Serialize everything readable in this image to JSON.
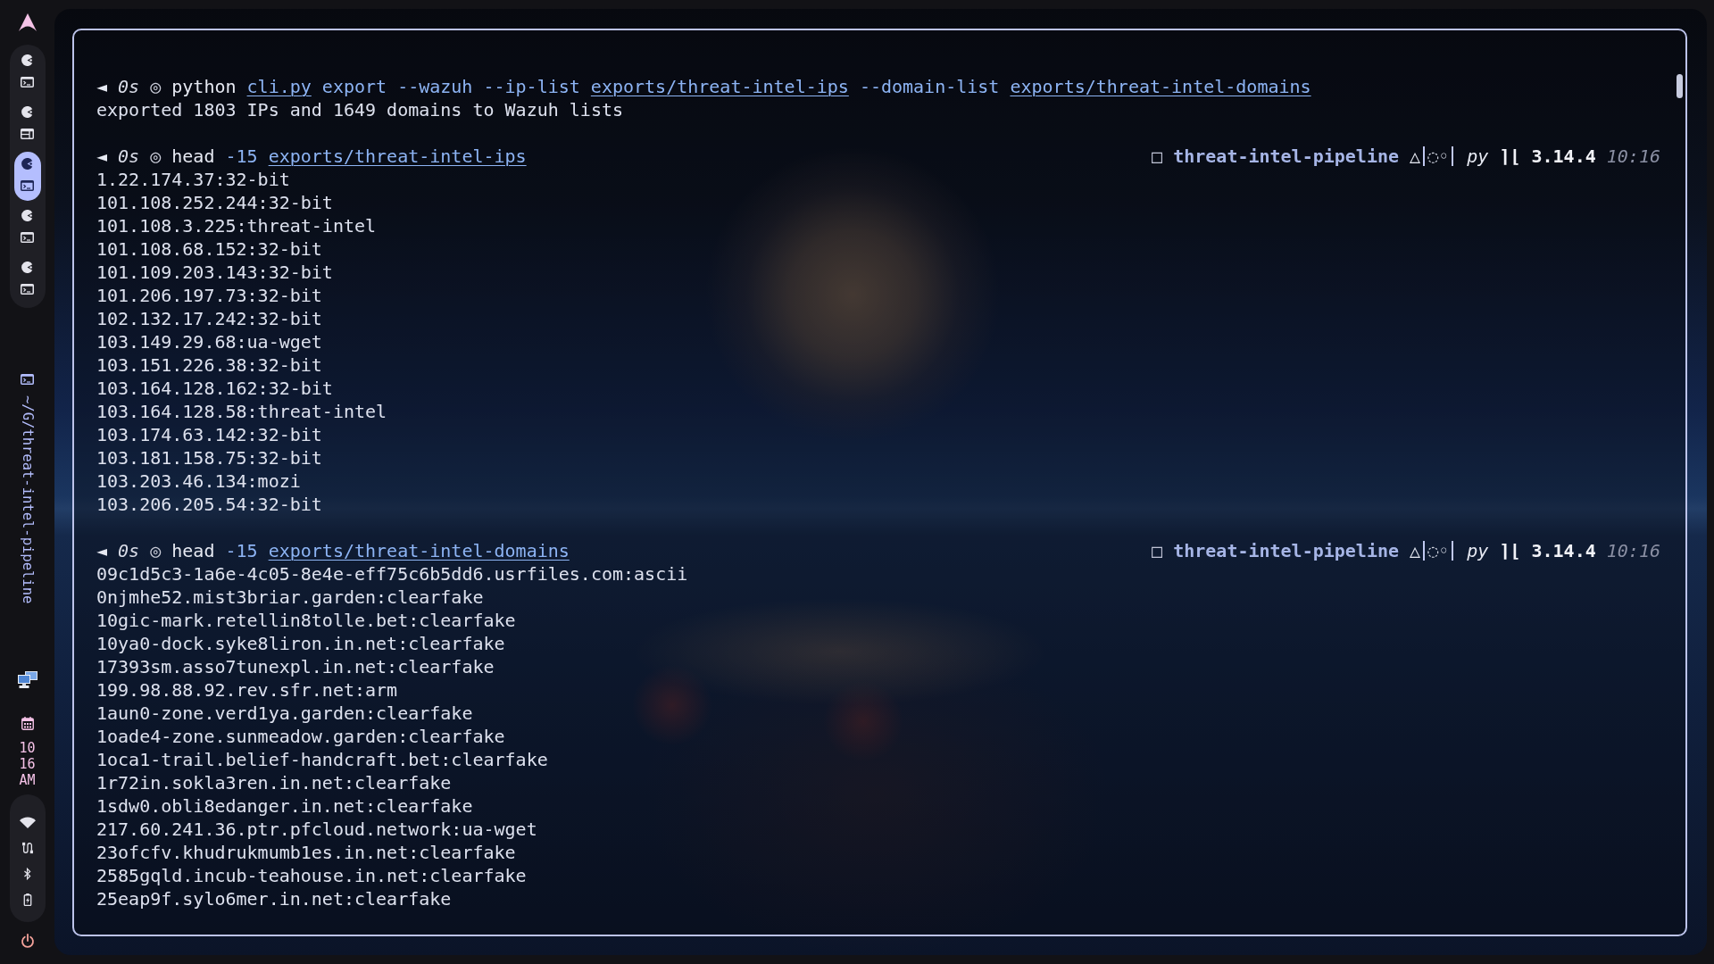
{
  "sidebar": {
    "workspaces": [
      {
        "kind": "terminal",
        "selected": false
      },
      {
        "kind": "window",
        "selected": false
      },
      {
        "kind": "terminal",
        "selected": true
      },
      {
        "kind": "terminal",
        "selected": false
      },
      {
        "kind": "terminal",
        "selected": false
      }
    ],
    "window_title": "~/G/threat-intel-pipeline",
    "clock": {
      "hour": "10",
      "minute": "16",
      "period": "AM"
    }
  },
  "terminal": {
    "blocks": [
      {
        "prompt": {
          "arrow": "◄",
          "duration": "0s",
          "status": "◎",
          "command": [
            {
              "kind": "cmd",
              "text": "python"
            },
            {
              "kind": "link",
              "text": "cli.py"
            },
            {
              "kind": "arg",
              "text": "export"
            },
            {
              "kind": "arg",
              "text": "--wazuh"
            },
            {
              "kind": "arg",
              "text": "--ip-list"
            },
            {
              "kind": "link",
              "text": "exports/threat-intel-ips"
            },
            {
              "kind": "arg",
              "text": "--domain-list"
            },
            {
              "kind": "link",
              "text": "exports/threat-intel-domains"
            }
          ]
        },
        "output": [
          "exported 1803 IPs and 1649 domains to Wazuh lists"
        ]
      },
      {
        "prompt": {
          "arrow": "◄",
          "duration": "0s",
          "status": "◎",
          "command": [
            {
              "kind": "cmd",
              "text": "head"
            },
            {
              "kind": "arg",
              "text": "-15"
            },
            {
              "kind": "link",
              "text": "exports/threat-intel-ips"
            }
          ]
        },
        "right_prompt": {
          "folder_icon": "□",
          "folder": "threat-intel-pipeline",
          "git_status": "△",
          "git_extra": "◌◦",
          "language": "py",
          "language_icon": "⌉⌊",
          "version": "3.14.4",
          "time": "10:16"
        },
        "output": [
          "1.22.174.37:32-bit",
          "101.108.252.244:32-bit",
          "101.108.3.225:threat-intel",
          "101.108.68.152:32-bit",
          "101.109.203.143:32-bit",
          "101.206.197.73:32-bit",
          "102.132.17.242:32-bit",
          "103.149.29.68:ua-wget",
          "103.151.226.38:32-bit",
          "103.164.128.162:32-bit",
          "103.164.128.58:threat-intel",
          "103.174.63.142:32-bit",
          "103.181.158.75:32-bit",
          "103.203.46.134:mozi",
          "103.206.205.54:32-bit"
        ]
      },
      {
        "prompt": {
          "arrow": "◄",
          "duration": "0s",
          "status": "◎",
          "command": [
            {
              "kind": "cmd",
              "text": "head"
            },
            {
              "kind": "arg",
              "text": "-15"
            },
            {
              "kind": "link",
              "text": "exports/threat-intel-domains"
            }
          ]
        },
        "right_prompt": {
          "folder_icon": "□",
          "folder": "threat-intel-pipeline",
          "git_status": "△",
          "git_extra": "◌◦",
          "language": "py",
          "language_icon": "⌉⌊",
          "version": "3.14.4",
          "time": "10:16"
        },
        "output": [
          "09c1d5c3-1a6e-4c05-8e4e-eff75c6b5dd6.usrfiles.com:ascii",
          "0njmhe52.mist3briar.garden:clearfake",
          "10gic-mark.retellin8tolle.bet:clearfake",
          "10ya0-dock.syke8liron.in.net:clearfake",
          "17393sm.asso7tunexpl.in.net:clearfake",
          "199.98.88.92.rev.sfr.net:arm",
          "1aun0-zone.verd1ya.garden:clearfake",
          "1oade4-zone.sunmeadow.garden:clearfake",
          "1oca1-trail.belief-handcraft.bet:clearfake",
          "1r72in.sokla3ren.in.net:clearfake",
          "1sdw0.obli8edanger.in.net:clearfake",
          "217.60.241.36.ptr.pfcloud.network:ua-wget",
          "23ofcfv.khudrukmumb1es.in.net:clearfake",
          "2585gqld.incub-teahouse.in.net:clearfake",
          "25eap9f.sylo6mer.in.net:clearfake"
        ]
      }
    ]
  }
}
